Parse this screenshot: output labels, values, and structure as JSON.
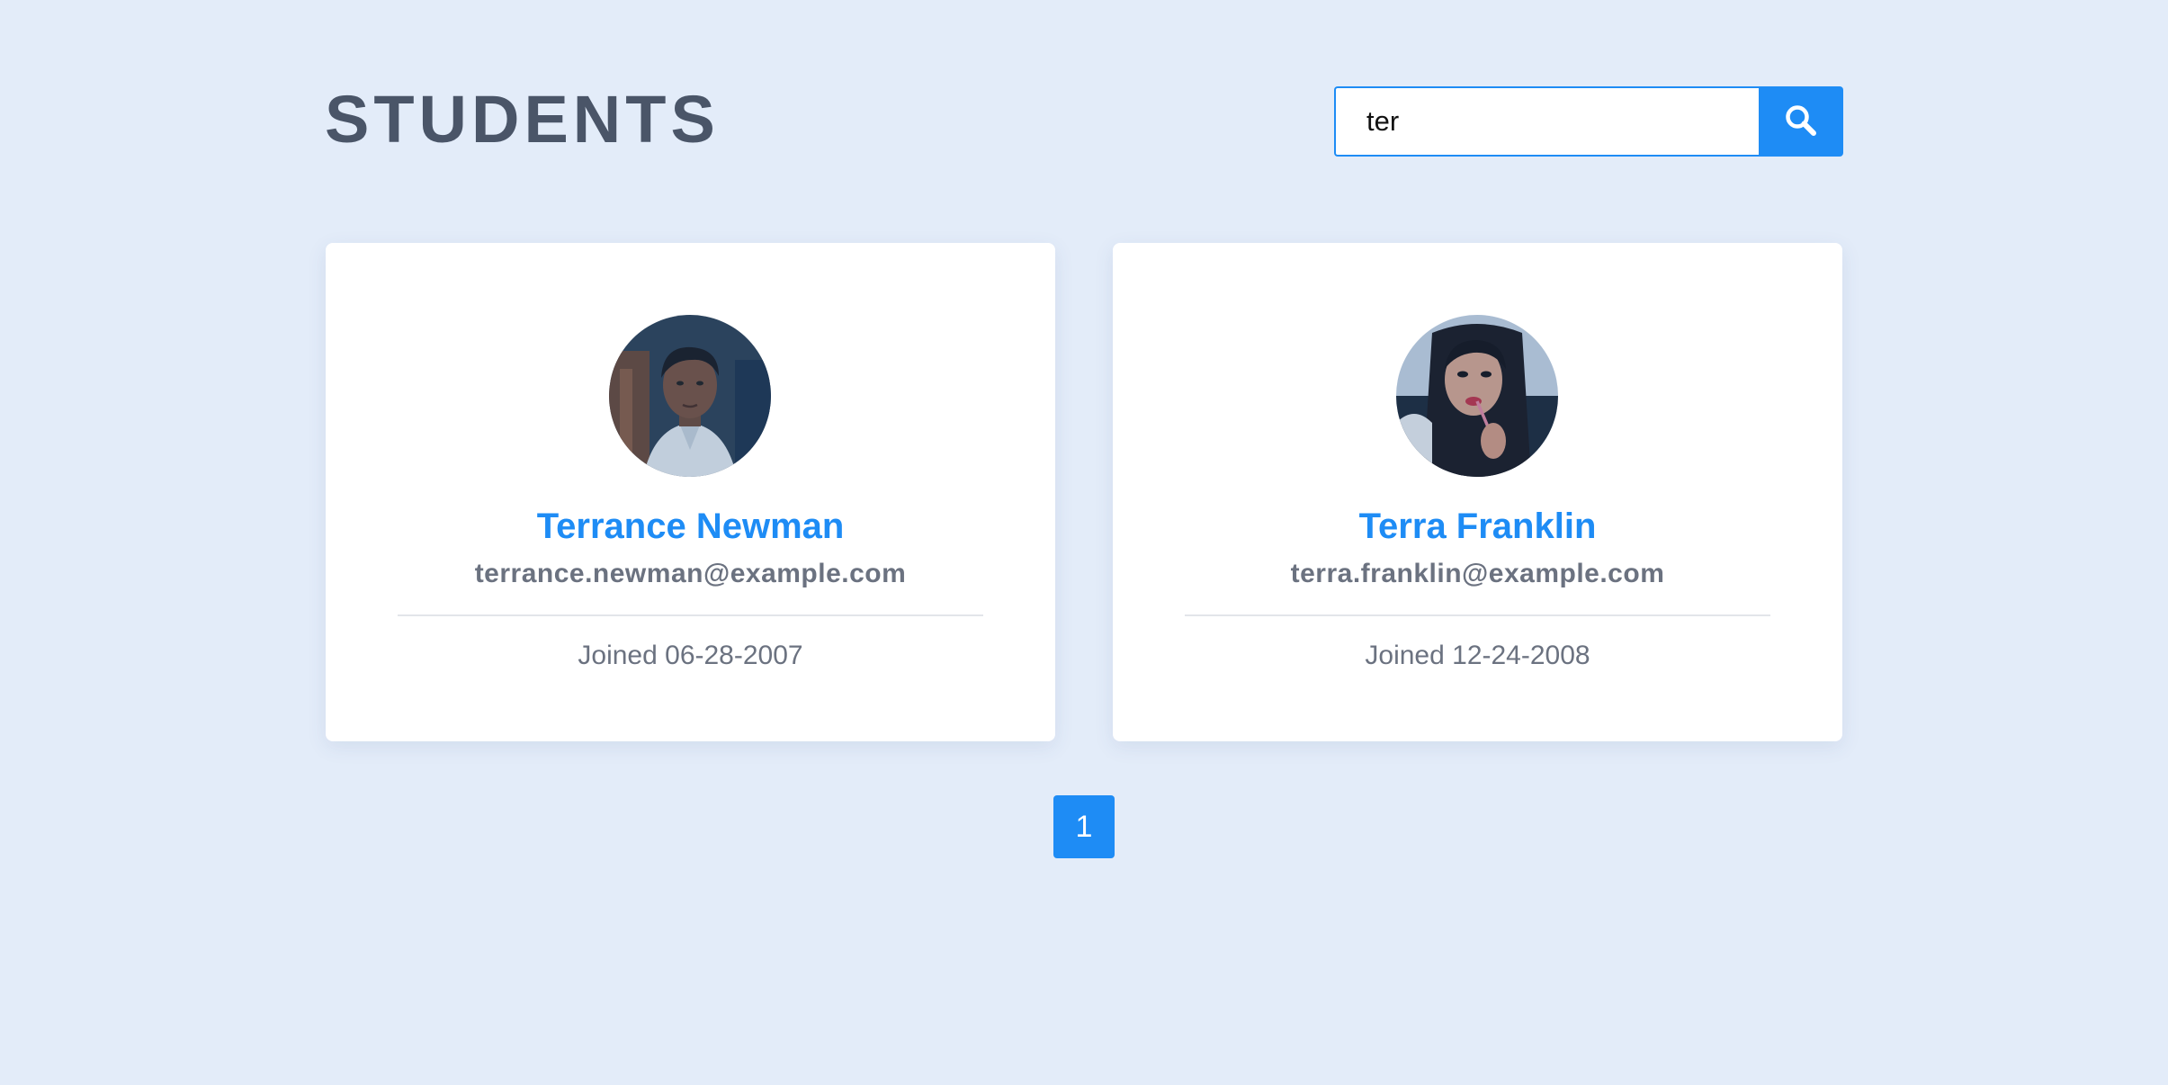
{
  "header": {
    "title": "STUDENTS"
  },
  "search": {
    "value": "ter",
    "button_icon": "search-icon"
  },
  "students": [
    {
      "name": "Terrance Newman",
      "email": "terrance.newman@example.com",
      "joined": "Joined 06-28-2007",
      "avatar_icon": "avatar-photo"
    },
    {
      "name": "Terra Franklin",
      "email": "terra.franklin@example.com",
      "joined": "Joined 12-24-2008",
      "avatar_icon": "avatar-photo"
    }
  ],
  "pagination": {
    "pages": [
      "1"
    ],
    "current": "1"
  },
  "colors": {
    "background": "#e3ecf9",
    "accent": "#1e8cf5",
    "title": "#4a5568",
    "muted_text": "#6b7280",
    "card": "#ffffff"
  }
}
